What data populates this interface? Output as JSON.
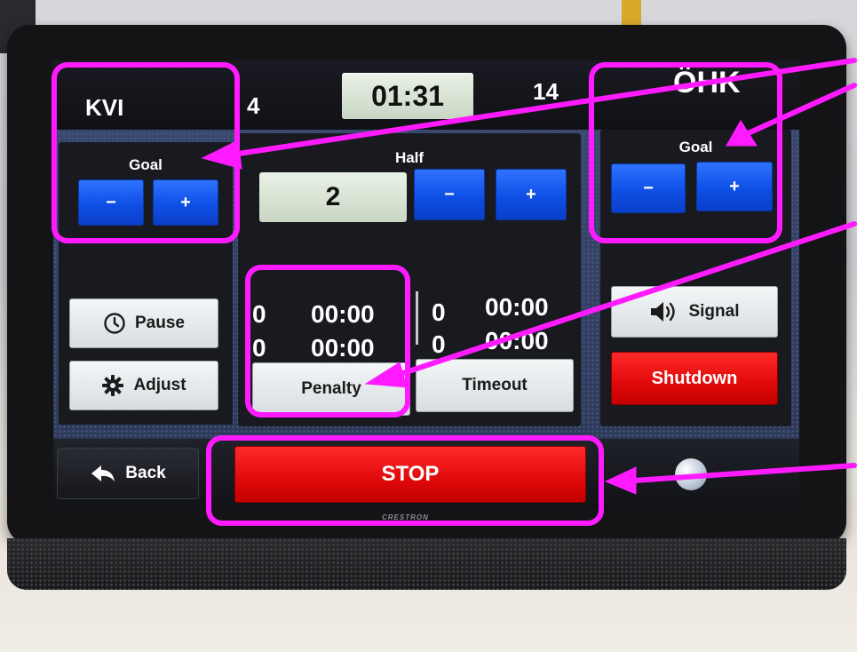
{
  "scoreboard": {
    "left_team": "KVI",
    "left_score": "4",
    "clock": "01:31",
    "right_score": "14",
    "right_team": "ÖHK"
  },
  "left_goal": {
    "label": "Goal",
    "minus": "−",
    "plus": "+"
  },
  "right_goal": {
    "label": "Goal",
    "minus": "−",
    "plus": "+"
  },
  "half": {
    "label": "Half",
    "value": "2",
    "minus": "−",
    "plus": "+"
  },
  "penalty": {
    "rows": [
      {
        "count": "0",
        "time": "00:00"
      },
      {
        "count": "0",
        "time": "00:00"
      }
    ],
    "button": "Penalty"
  },
  "timeout": {
    "rows": [
      {
        "count": "0",
        "time": "00:00"
      },
      {
        "count": "0",
        "time": "00:00"
      }
    ],
    "button": "Timeout"
  },
  "left_controls": {
    "pause": "Pause",
    "adjust": "Adjust"
  },
  "right_controls": {
    "signal": "Signal",
    "shutdown": "Shutdown"
  },
  "bottom": {
    "back": "Back",
    "stop": "STOP"
  },
  "device_brand": "CRESTRON",
  "icons": [
    "clock-icon",
    "gear-icon",
    "speaker-icon",
    "back-arrow-icon"
  ],
  "colors": {
    "accent_blue": "#1f5cf2",
    "stop_red": "#e60a0a",
    "annotation": "#ff1aff"
  }
}
